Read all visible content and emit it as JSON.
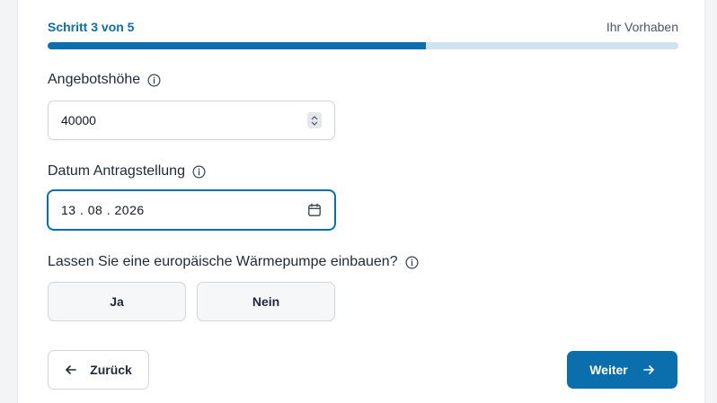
{
  "progress": {
    "step_label": "Schritt 3 von 5",
    "section_title": "Ihr Vorhaben",
    "fraction": 0.6
  },
  "offer_amount": {
    "label": "Angebotshöhe",
    "value": "40000"
  },
  "application_date": {
    "label": "Datum Antragstellung",
    "day": "13",
    "month": "08",
    "year": "2026"
  },
  "heat_pump_question": {
    "label": "Lassen Sie eine europäische Wärmepumpe einbauen?",
    "yes_label": "Ja",
    "no_label": "Nein"
  },
  "navigation": {
    "back_label": "Zurück",
    "next_label": "Weiter"
  },
  "colors": {
    "accent": "#0b6fad",
    "progress_track": "#cfe4f1"
  }
}
